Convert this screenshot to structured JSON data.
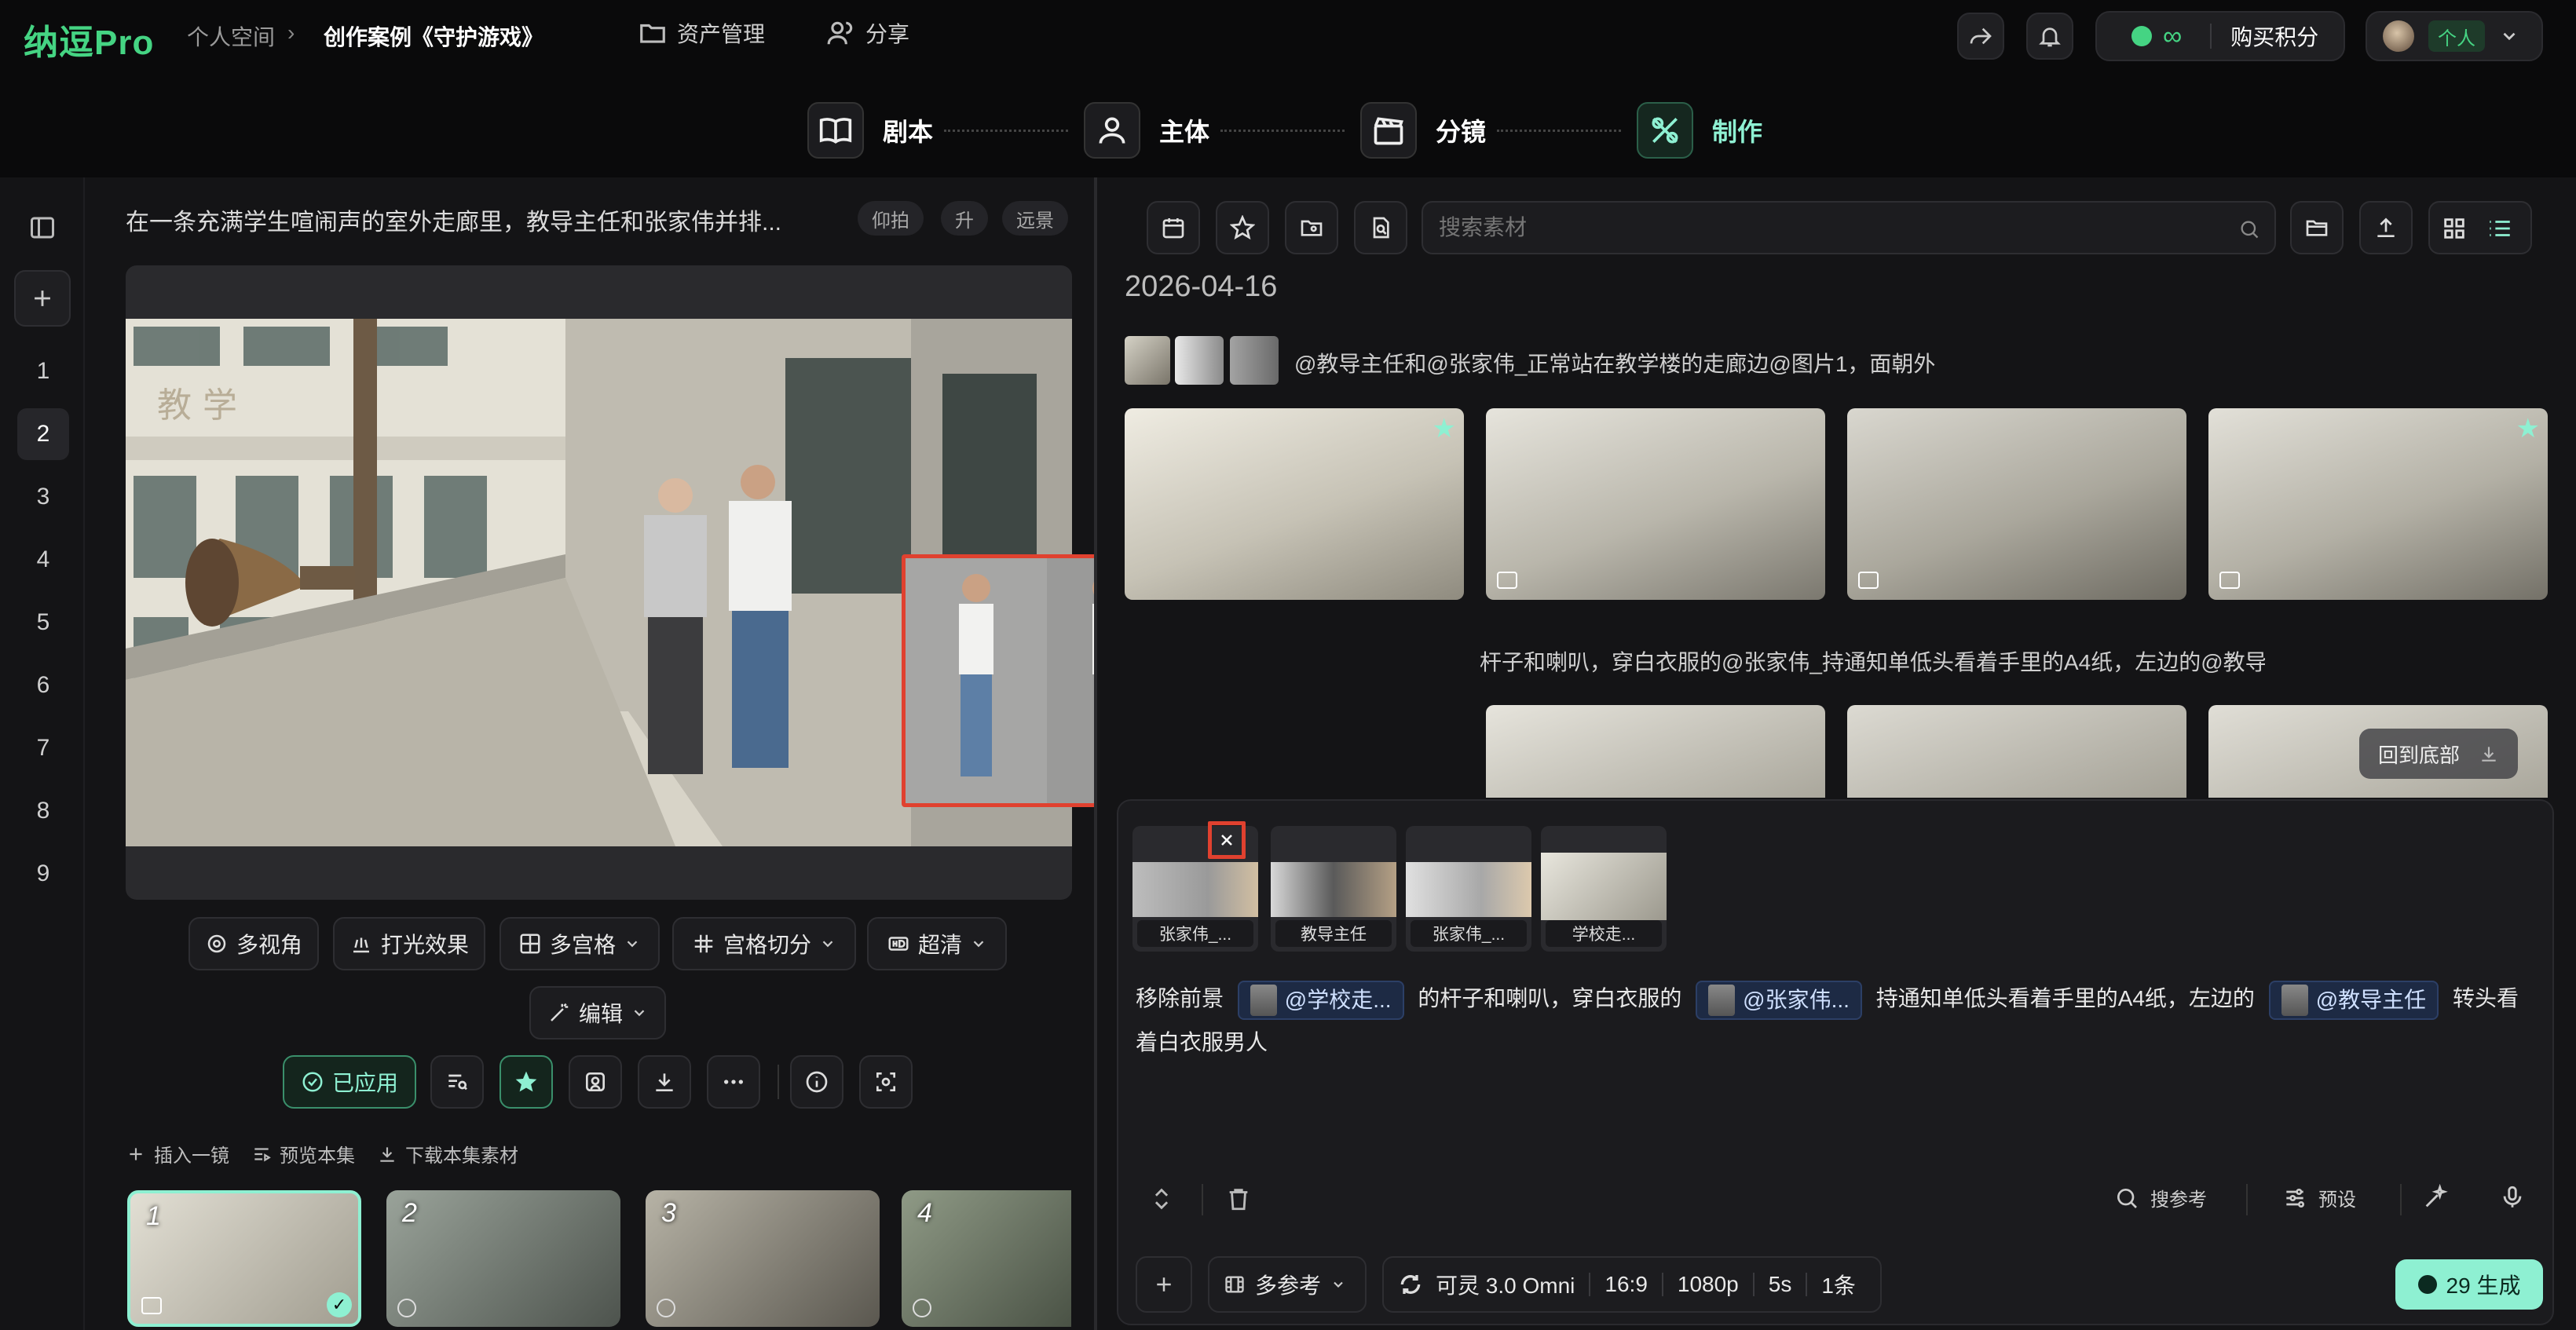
{
  "app": {
    "logo": "纳逗Pro"
  },
  "breadcrumb": {
    "root": "个人空间",
    "current": "创作案例《守护游戏》"
  },
  "topnav": {
    "assets": "资产管理",
    "share": "分享"
  },
  "account": {
    "credits_symbol": "∞",
    "buy_label": "购买积分",
    "workspace": "个人"
  },
  "steps": [
    {
      "label": "剧本",
      "icon": "book-icon"
    },
    {
      "label": "主体",
      "icon": "person-icon"
    },
    {
      "label": "分镜",
      "icon": "clapper-icon"
    },
    {
      "label": "制作",
      "icon": "tools-icon"
    }
  ],
  "sidebar": {
    "shots": [
      "1",
      "2",
      "3",
      "4",
      "5",
      "6",
      "7",
      "8",
      "9"
    ],
    "active": "2"
  },
  "shot": {
    "prompt": "在一条充满学生喧闹声的室外走廊里，教导主任和张家伟并排...",
    "tags": [
      "仰拍",
      "升",
      "远景"
    ],
    "tools": {
      "multi_view": "多视角",
      "lighting": "打光效果",
      "multi_grid": "多宫格",
      "grid_cut": "宫格切分",
      "hd": "超清",
      "edit": "编辑"
    },
    "applied": "已应用",
    "actions": {
      "insert": "插入一镜",
      "preview": "预览本集",
      "download": "下载本集素材"
    },
    "thumbs": [
      "1",
      "2",
      "3",
      "4"
    ]
  },
  "gallery": {
    "search_placeholder": "搜索素材",
    "date": "2026-04-16",
    "group1_prompt": "@教导主任和@张家伟_正常站在教学楼的走廊边@图片1，面朝外",
    "group2_prompt": "杆子和喇叭，穿白衣服的@张家伟_持通知单低头看着手里的A4纸，左边的@教导...",
    "back_to_bottom": "回到底部"
  },
  "composer": {
    "refs": [
      "张家伟_...",
      "教导主任",
      "张家伟_...",
      "学校走..."
    ],
    "prompt": {
      "p1": "移除前景",
      "m1": "@学校走...",
      "p2": "的杆子和喇叭，穿白衣服的",
      "m2": "@张家伟...",
      "p3": "持通知单低头看着手里的A4纸，左边的",
      "m3": "@教导主任",
      "p4": "转头看着白衣服男人"
    },
    "search_ref": "搜参考",
    "preset": "预设",
    "multi_ref": "多参考",
    "model": "可灵 3.0 Omni",
    "ratio": "16:9",
    "resolution": "1080p",
    "duration": "5s",
    "count": "1条",
    "generate": "29 生成"
  },
  "colors": {
    "brand": "#45d483",
    "selection": "#e0412f",
    "teal": "#8ef0d2"
  }
}
